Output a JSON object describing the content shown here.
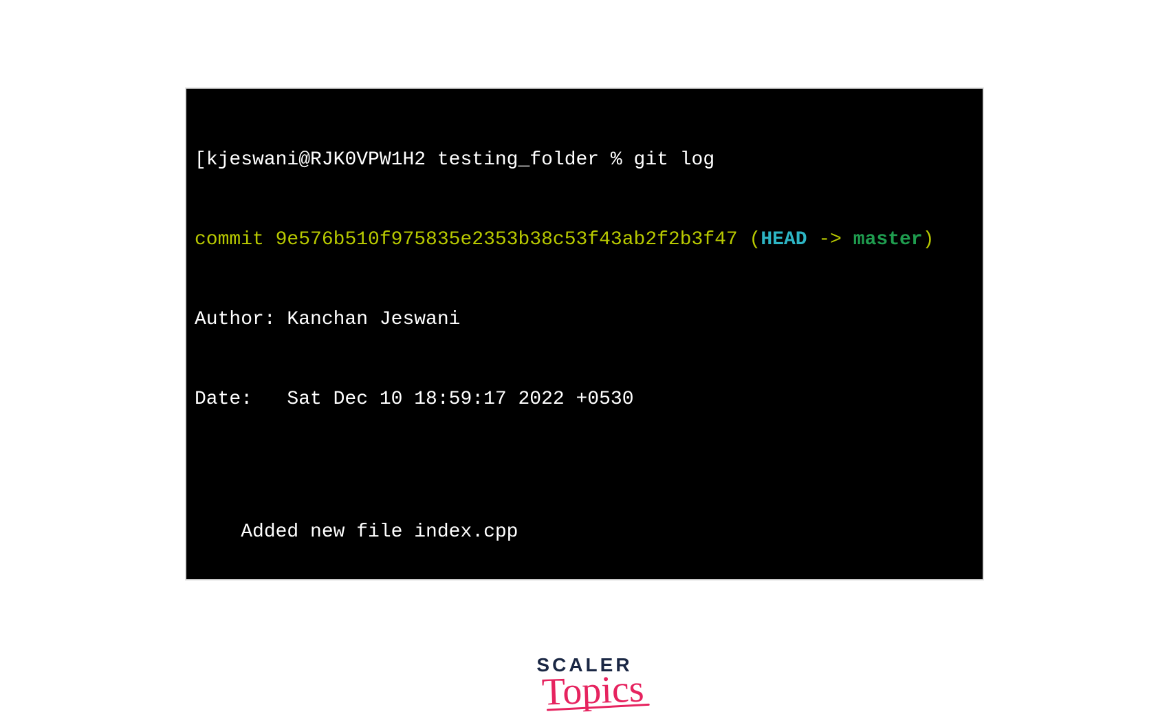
{
  "terminal": {
    "prompt_bracket": "[",
    "prompt": "kjeswani@RJK0VPW1H2 testing_folder % ",
    "command": "git log",
    "commit_prefix": "commit ",
    "commit_hash": "9e576b510f975835e2353b38c53f43ab2f2b3f47",
    "ref_open": " (",
    "ref_head": "HEAD",
    "ref_arrow": " -> ",
    "ref_branch": "master",
    "ref_close": ")",
    "author_line": "Author: Kanchan Jeswani",
    "date_line": "Date:   Sat Dec 10 18:59:17 2022 +0530",
    "blank_line": "",
    "message_line": "    Added new file index.cpp"
  },
  "logo": {
    "line1": "SCALER",
    "line2": "Topics"
  }
}
